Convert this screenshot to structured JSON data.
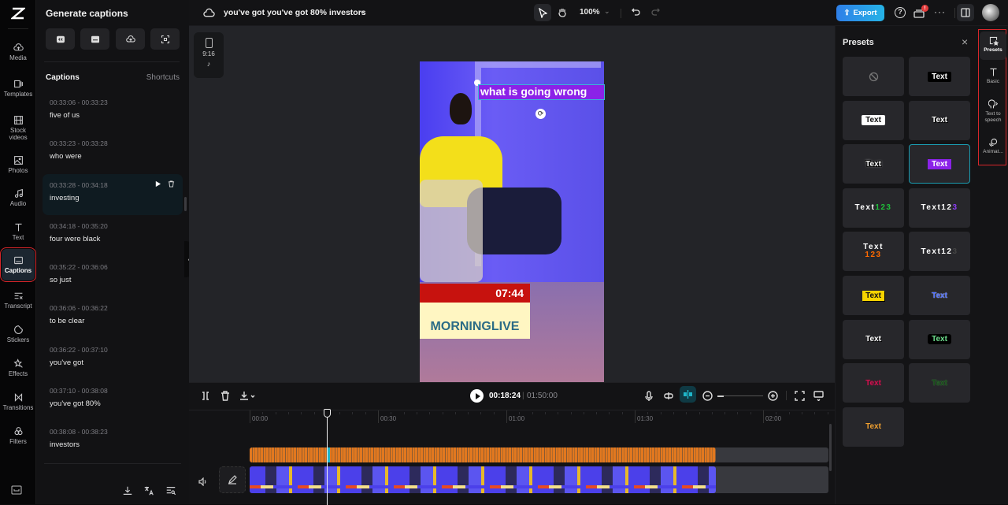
{
  "app": {
    "project_title": "you've got you've got 80% investors"
  },
  "left_rail": {
    "items": [
      {
        "label": "Media",
        "icon": "cloud-upload-icon"
      },
      {
        "label": "Templates",
        "icon": "templates-icon"
      },
      {
        "label": "Stock videos",
        "icon": "film-icon"
      },
      {
        "label": "Photos",
        "icon": "image-icon"
      },
      {
        "label": "Audio",
        "icon": "music-icon"
      },
      {
        "label": "Text",
        "icon": "text-icon"
      },
      {
        "label": "Captions",
        "icon": "captions-icon",
        "active": true
      },
      {
        "label": "Transcript",
        "icon": "transcript-icon"
      },
      {
        "label": "Stickers",
        "icon": "sticker-icon"
      },
      {
        "label": "Effects",
        "icon": "effects-icon"
      },
      {
        "label": "Transitions",
        "icon": "transitions-icon"
      },
      {
        "label": "Filters",
        "icon": "filters-icon"
      }
    ]
  },
  "captions_panel": {
    "title": "Generate captions",
    "section_title": "Captions",
    "shortcuts_label": "Shortcuts",
    "items": [
      {
        "time": "00:33:06 - 00:33:23",
        "text": "five of us"
      },
      {
        "time": "00:33:23 - 00:33:28",
        "text": "who were"
      },
      {
        "time": "00:33:28 - 00:34:18",
        "text": "investing",
        "active": true
      },
      {
        "time": "00:34:18 - 00:35:20",
        "text": "four were black"
      },
      {
        "time": "00:35:22 - 00:36:06",
        "text": "so just"
      },
      {
        "time": "00:36:06 - 00:36:22",
        "text": "to be clear"
      },
      {
        "time": "00:36:22 - 00:37:10",
        "text": "you've got"
      },
      {
        "time": "00:37:10 - 00:38:08",
        "text": "you've got 80%"
      },
      {
        "time": "00:38:08 - 00:38:23",
        "text": "investors"
      }
    ]
  },
  "toolbar": {
    "zoom": "100%",
    "export_label": "Export",
    "notification_badge": "!"
  },
  "canvas": {
    "aspect_ratio": "9:16",
    "caption_text": "what is going wrong",
    "video_overlay": {
      "clock": "07:44",
      "brand": "MORNINGLIVE"
    }
  },
  "playback": {
    "current_time": "00:18:24",
    "total_time": "01:50:00",
    "separator": "|"
  },
  "timeline": {
    "ticks": [
      "00:00",
      "00:30",
      "01:00",
      "01:30",
      "02:00"
    ],
    "playhead_fraction": 0.185
  },
  "presets_panel": {
    "title": "Presets",
    "items": [
      {
        "label": "",
        "style": "none"
      },
      {
        "label": "Text",
        "style": "white-on-black"
      },
      {
        "label": "Text",
        "style": "black-on-white"
      },
      {
        "label": "Text",
        "style": "white-outline"
      },
      {
        "label": "Text",
        "style": "white-heavy-outline"
      },
      {
        "label": "Text",
        "style": "white-on-purple",
        "selected": true
      },
      {
        "label": "Text",
        "suffix": "123",
        "style": "green-digits"
      },
      {
        "label": "Text12",
        "suffix": "3",
        "style": "purple-digit"
      },
      {
        "label": "Text",
        "suffix": "123",
        "style": "orange-digits-stacked"
      },
      {
        "label": "Text12",
        "suffix": "3",
        "style": "shadow-digit"
      },
      {
        "label": "Text",
        "style": "black-on-yellow"
      },
      {
        "label": "Text",
        "style": "blue"
      },
      {
        "label": "Text",
        "style": "plain-white"
      },
      {
        "label": "Text",
        "style": "green-on-black"
      },
      {
        "label": "Text",
        "style": "crimson"
      },
      {
        "label": "Text",
        "style": "dark-green"
      },
      {
        "label": "Text",
        "style": "orange"
      }
    ]
  },
  "right_rail": {
    "items": [
      {
        "label": "Presets",
        "active": true
      },
      {
        "label": "Basic"
      },
      {
        "label": "Text to speech"
      },
      {
        "label": "Animat..."
      }
    ]
  },
  "colors": {
    "accent": "#1fb6c9",
    "export": "#2f8fe8",
    "caption_bg": "#8b22e8",
    "highlight": "#d8262a"
  }
}
